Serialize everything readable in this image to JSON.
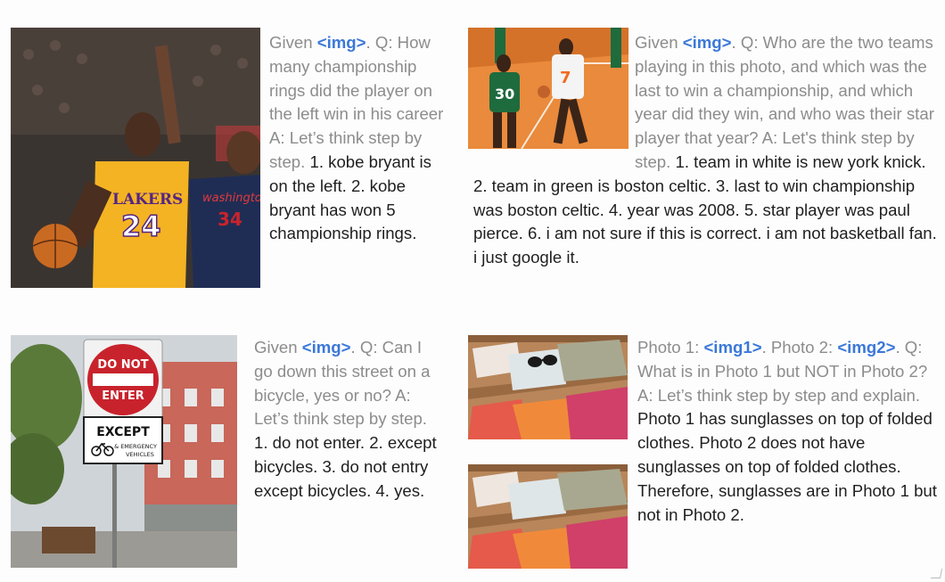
{
  "panels": [
    {
      "prompt_pre": "Given ",
      "img_token": "<img>",
      "prompt_post": ". Q: How many championship rings did the player on the left win in his career A: Let’s think step by step. ",
      "answer": "1. kobe bryant is on the left. 2. kobe bryant has won 5 championship rings.",
      "photo": {
        "jersey_left_team": "LAKERS",
        "jersey_left_number": "24",
        "jersey_right_team": "washington",
        "jersey_right_number": "34"
      }
    },
    {
      "prompt_pre": "Given ",
      "img_token": "<img>",
      "prompt_post": ". Q: Who are the two teams playing in this photo, and which was the last to win a championship, and which year did they win, and who was their star player that year? A: Let's think step by step. ",
      "answer": "1. team in white is new york knick. 2. team in green is boston celtic. 3. last to win championship was boston celtic. 4. year was 2008. 5. star player was paul pierce. 6. i am not sure if this is correct. i am not basketball fan. i just google it.",
      "photo": {
        "green_number": "30",
        "white_number": "7"
      }
    },
    {
      "prompt_pre": "Given ",
      "img_token": "<img>",
      "prompt_post": ". Q: Can I go down this street on a bicycle, yes or no? A: Let’s think step by step. ",
      "answer": "1. do not enter. 2. except bicycles. 3. do not entry except bicycles. 4. yes.",
      "photo": {
        "sign_line1": "DO NOT",
        "sign_line2": "ENTER",
        "plate_line1": "EXCEPT",
        "plate_line2a": "& EMERGENCY",
        "plate_line2b": "VEHICLES"
      }
    },
    {
      "prompt_pre": "Photo 1: ",
      "img_token": "<img1>",
      "prompt_mid": ". Photo 2: ",
      "img_token2": "<img2>",
      "prompt_post": ". Q: What is in Photo 1 but NOT in Photo 2? A: Let’s think step by step and explain. ",
      "answer": "Photo 1 has sunglasses on top of folded clothes. Photo 2 does not have sunglasses on top of folded clothes. Therefore, sunglasses are in Photo 1 but not in Photo 2."
    }
  ],
  "colors": {
    "prompt": "#8c8c8c",
    "token": "#3b78d8",
    "answer": "#1f1f1f"
  }
}
